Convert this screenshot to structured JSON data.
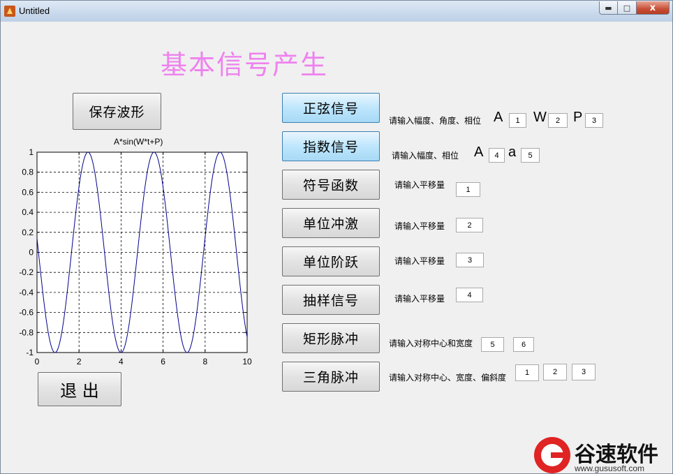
{
  "window": {
    "title": "Untitled",
    "min_label": "▬",
    "max_label": "□",
    "close_label": "x"
  },
  "main_title": "基本信号产生",
  "buttons": {
    "save_waveform": "保存波形",
    "exit": "退  出",
    "sine": "正弦信号",
    "exponential": "指数信号",
    "sign_function": "符号函数",
    "unit_impulse": "单位冲激",
    "unit_step": "单位阶跃",
    "sampling": "抽样信号",
    "rect_pulse": "矩形脉冲",
    "tri_pulse": "三角脉冲"
  },
  "params": {
    "sine": {
      "label": "请输入幅度、角度、相位",
      "A_label": "A",
      "W_label": "W",
      "P_label": "P",
      "A": "1",
      "W": "2",
      "P": "3"
    },
    "exponential": {
      "label": "请输入幅度、相位",
      "A_label": "A",
      "a_label": "a",
      "A": "4",
      "a": "5"
    },
    "sign_function": {
      "label": "请输入平移量",
      "shift": "1"
    },
    "unit_impulse": {
      "label": "请输入平移量",
      "shift": "2"
    },
    "unit_step": {
      "label": "请输入平移量",
      "shift": "3"
    },
    "sampling": {
      "label": "请输入平移量",
      "shift": "4"
    },
    "rect_pulse": {
      "label": "请输入对称中心和宽度",
      "center": "5",
      "width": "6"
    },
    "tri_pulse": {
      "label": "请输入对称中心、宽度、偏斜度",
      "center": "1",
      "width": "2",
      "skew": "3"
    }
  },
  "chart_data": {
    "type": "line",
    "title": "A*sin(W*t+P)",
    "xlabel": "",
    "ylabel": "",
    "xlim": [
      0,
      10
    ],
    "ylim": [
      -1,
      1
    ],
    "x_ticks": [
      "0",
      "2",
      "4",
      "6",
      "8",
      "10"
    ],
    "y_ticks": [
      "1",
      "0.8",
      "0.6",
      "0.4",
      "0.2",
      "0",
      "-0.2",
      "-0.4",
      "-0.6",
      "-0.8",
      "-1"
    ],
    "grid": true,
    "series": [
      {
        "function": "A*sin(W*t+P)",
        "A": 1,
        "W": 2,
        "P": 3,
        "x_start": 0,
        "x_end": 10,
        "color": "#00008b"
      }
    ]
  },
  "watermark": {
    "text": "谷速软件",
    "url": "www.gususoft.com"
  },
  "colors": {
    "title_color": "#ee82ee",
    "active_button": "#bee6fd",
    "plot_line": "#00008b"
  }
}
